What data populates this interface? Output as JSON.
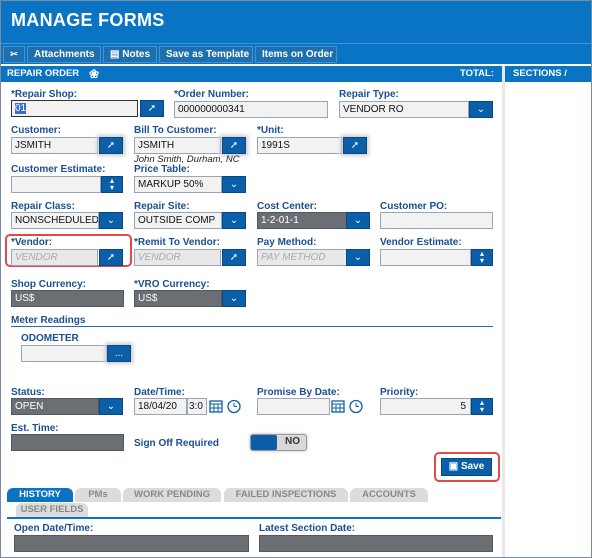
{
  "window": {
    "title": "MANAGE FORMS"
  },
  "toolbar": {
    "items": [
      {
        "label": ""
      },
      {
        "label": "Attachments"
      },
      {
        "label": "Notes"
      },
      {
        "label": "Save as Template"
      },
      {
        "label": "Items on Order"
      }
    ]
  },
  "sections": {
    "repair_order": "REPAIR ORDER",
    "total": "TOTAL:",
    "sections_lines": "SECTIONS / LINE"
  },
  "form": {
    "repair_shop": {
      "label": "*Repair Shop:",
      "value": "01"
    },
    "order_number": {
      "label": "*Order Number:",
      "value": "000000000341"
    },
    "repair_type": {
      "label": "Repair Type:",
      "value": "VENDOR RO"
    },
    "customer": {
      "label": "Customer:",
      "value": "JSMITH"
    },
    "bill_to_customer": {
      "label": "Bill To Customer:",
      "value": "JSMITH",
      "hint": "John Smith, Durham, NC"
    },
    "unit": {
      "label": "*Unit:",
      "value": "1991S"
    },
    "customer_estimate": {
      "label": "Customer Estimate:",
      "value": ""
    },
    "price_table": {
      "label": "Price Table:",
      "value": "MARKUP 50%"
    },
    "repair_class": {
      "label": "Repair Class:",
      "value": "NONSCHEDULED"
    },
    "repair_site": {
      "label": "Repair Site:",
      "value": "OUTSIDE COMP"
    },
    "cost_center": {
      "label": "Cost Center:",
      "value": "1-2-01-1"
    },
    "customer_po": {
      "label": "Customer PO:",
      "value": ""
    },
    "vendor": {
      "label": "*Vendor:",
      "placeholder": "VENDOR"
    },
    "remit_to_vendor": {
      "label": "*Remit To Vendor:",
      "placeholder": "VENDOR"
    },
    "pay_method": {
      "label": "Pay Method:",
      "placeholder": "PAY METHOD"
    },
    "vendor_estimate": {
      "label": "Vendor Estimate:",
      "value": ""
    },
    "shop_currency": {
      "label": "Shop Currency:",
      "value": "US$"
    },
    "vro_currency": {
      "label": "*VRO Currency:",
      "value": "US$"
    },
    "meter_readings": {
      "label": "Meter Readings"
    },
    "odometer": {
      "label": "ODOMETER",
      "value": "",
      "button": "..."
    },
    "status": {
      "label": "Status:",
      "value": "OPEN"
    },
    "date_time": {
      "label": "Date/Time:",
      "date": "18/04/20",
      "time": "3:0"
    },
    "promise_by_date": {
      "label": "Promise By Date:",
      "value": ""
    },
    "priority": {
      "label": "Priority:",
      "value": "5"
    },
    "est_time": {
      "label": "Est. Time:",
      "value": ""
    },
    "sign_off": {
      "label": "Sign Off Required",
      "toggle": "NO"
    },
    "save": {
      "label": "Save"
    }
  },
  "tabs": [
    {
      "label": "HISTORY",
      "active": true
    },
    {
      "label": "PMs",
      "active": false
    },
    {
      "label": "WORK PENDING",
      "active": false
    },
    {
      "label": "FAILED INSPECTIONS",
      "active": false
    },
    {
      "label": "ACCOUNTS",
      "active": false
    },
    {
      "label": "USER FIELDS",
      "active": false
    }
  ],
  "history": {
    "open_date_time": {
      "label": "Open Date/Time:",
      "value": ""
    },
    "latest_section_date": {
      "label": "Latest Section Date:",
      "value": ""
    }
  }
}
